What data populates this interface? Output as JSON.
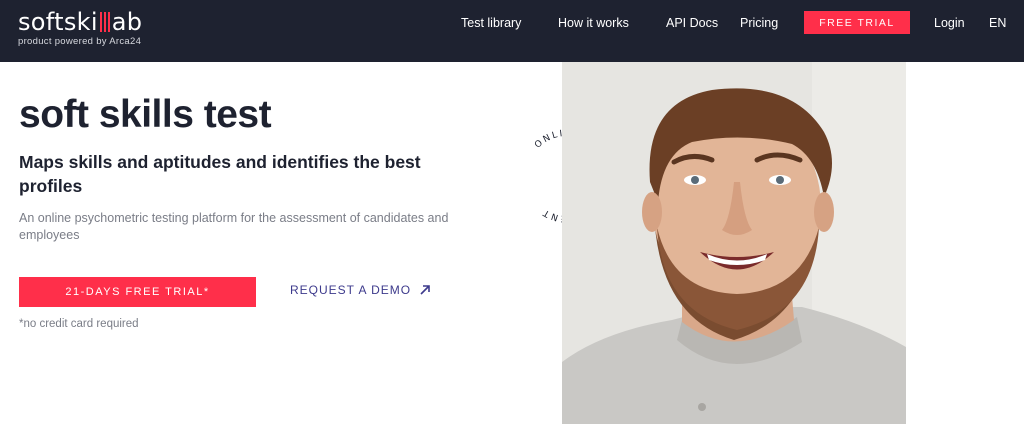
{
  "brand": {
    "logo_left": "softski",
    "logo_right": "ab",
    "tagline": "product powered by Arca24",
    "accent_color": "#ff2f4a",
    "nav_bg": "#1e2230"
  },
  "nav": {
    "items": [
      {
        "label": "Test library"
      },
      {
        "label": "How it works"
      },
      {
        "label": "API Docs"
      },
      {
        "label": "Pricing"
      }
    ],
    "cta_label": "FREE TRIAL",
    "login_label": "Login",
    "language": "EN"
  },
  "hero": {
    "title": "soft skills test",
    "subtitle": "Maps skills and aptitudes and identifies the best profiles",
    "description": "An online psychometric testing platform for the assessment of candidates and employees",
    "primary_cta": "21-DAYS FREE TRIAL*",
    "secondary_cta": "REQUEST A DEMO",
    "secondary_icon": "arrow-up-right-icon",
    "note": "*no credit card required",
    "badge_text": "ONLINE SKILLS ASSESSMENT"
  },
  "image": {
    "subject": "smiling-man-photo"
  }
}
